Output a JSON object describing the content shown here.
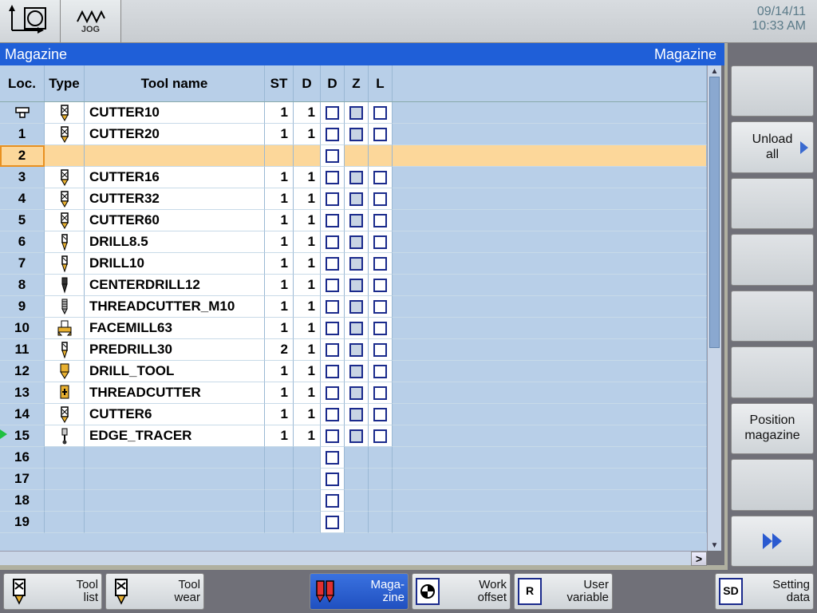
{
  "datetime": {
    "date": "09/14/11",
    "time": "10:33 AM"
  },
  "mode_label": "JOG",
  "title_left": "Magazine",
  "title_right": "Magazine",
  "columns": {
    "loc": "Loc.",
    "type": "Type",
    "name": "Tool name",
    "st": "ST",
    "d1": "D",
    "d2": "D",
    "z": "Z",
    "l": "L"
  },
  "rows": [
    {
      "loc_icon": "spindle",
      "type_icon": "endmill",
      "name": "CUTTER10",
      "st": "1",
      "d": "1",
      "empty": false
    },
    {
      "loc": "1",
      "type_icon": "endmill",
      "name": "CUTTER20",
      "st": "1",
      "d": "1",
      "empty": false
    },
    {
      "loc": "2",
      "empty": true,
      "selected": true
    },
    {
      "loc": "3",
      "type_icon": "endmill",
      "name": "CUTTER16",
      "st": "1",
      "d": "1",
      "empty": false
    },
    {
      "loc": "4",
      "type_icon": "endmill",
      "name": "CUTTER32",
      "st": "1",
      "d": "1",
      "empty": false
    },
    {
      "loc": "5",
      "type_icon": "endmill",
      "name": "CUTTER60",
      "st": "1",
      "d": "1",
      "empty": false
    },
    {
      "loc": "6",
      "type_icon": "drill",
      "name": "DRILL8.5",
      "st": "1",
      "d": "1",
      "empty": false
    },
    {
      "loc": "7",
      "type_icon": "drill",
      "name": "DRILL10",
      "st": "1",
      "d": "1",
      "empty": false
    },
    {
      "loc": "8",
      "type_icon": "centerdrill",
      "name": "CENTERDRILL12",
      "st": "1",
      "d": "1",
      "empty": false
    },
    {
      "loc": "9",
      "type_icon": "tap",
      "name": "THREADCUTTER_M10",
      "st": "1",
      "d": "1",
      "empty": false
    },
    {
      "loc": "10",
      "type_icon": "facemill",
      "name": "FACEMILL63",
      "st": "1",
      "d": "1",
      "empty": false
    },
    {
      "loc": "11",
      "type_icon": "drill",
      "name": "PREDRILL30",
      "st": "2",
      "d": "1",
      "empty": false
    },
    {
      "loc": "12",
      "type_icon": "drilltool",
      "name": "DRILL_TOOL",
      "st": "1",
      "d": "1",
      "empty": false
    },
    {
      "loc": "13",
      "type_icon": "threadtool",
      "name": "THREADCUTTER",
      "st": "1",
      "d": "1",
      "empty": false
    },
    {
      "loc": "14",
      "type_icon": "endmill",
      "name": "CUTTER6",
      "st": "1",
      "d": "1",
      "empty": false
    },
    {
      "loc": "15",
      "type_icon": "probe",
      "name": "EDGE_TRACER",
      "st": "1",
      "d": "1",
      "empty": false,
      "green_marker": true
    },
    {
      "loc": "16",
      "empty": true
    },
    {
      "loc": "17",
      "empty": true
    },
    {
      "loc": "18",
      "empty": true
    },
    {
      "loc": "19",
      "empty": true
    }
  ],
  "right_keys": [
    {
      "id": "blank1",
      "label": "",
      "blank": true
    },
    {
      "id": "unload-all",
      "label": "Unload\nall",
      "arrow": true
    },
    {
      "id": "blank2",
      "label": "",
      "blank": true
    },
    {
      "id": "blank3",
      "label": "",
      "blank": true
    },
    {
      "id": "blank4",
      "label": "",
      "blank": true
    },
    {
      "id": "blank5",
      "label": "",
      "blank": true
    },
    {
      "id": "position-magazine",
      "label": "Position\nmagazine"
    },
    {
      "id": "blank6",
      "label": "",
      "blank": true
    },
    {
      "id": "next",
      "label": "",
      "dbl_arrow": true
    }
  ],
  "bottom_keys": {
    "tool_list": "Tool\nlist",
    "tool_wear": "Tool\nwear",
    "magazine": "Maga-\nzine",
    "work_offset": "Work\noffset",
    "user_variable": "User\nvariable",
    "setting_data": "Setting\ndata",
    "sd_badge": "SD",
    "r_badge": "R"
  }
}
